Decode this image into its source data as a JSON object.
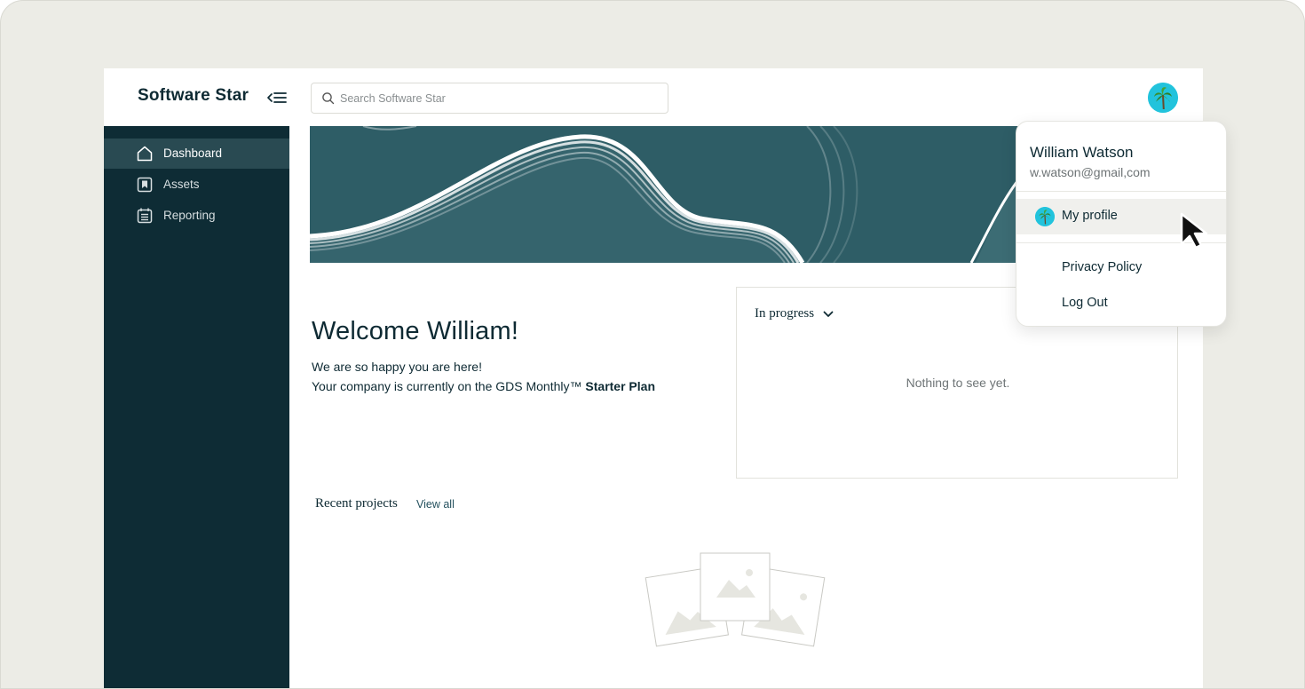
{
  "header": {
    "brand": "Software Star",
    "search_placeholder": "Search Software Star"
  },
  "sidebar": {
    "items": [
      {
        "label": "Dashboard",
        "icon": "home-icon",
        "active": true
      },
      {
        "label": "Assets",
        "icon": "assets-icon",
        "active": false
      },
      {
        "label": "Reporting",
        "icon": "reporting-icon",
        "active": false
      }
    ]
  },
  "welcome": {
    "title": "Welcome William!",
    "line1": "We are so happy you are here!",
    "line2_prefix": "Your company is currently on the GDS Monthly™ ",
    "line2_plan": "Starter Plan"
  },
  "progress": {
    "toggle_label": "In progress",
    "empty_message": "Nothing to see yet."
  },
  "recent": {
    "title": "Recent projects",
    "view_all": "View all"
  },
  "user_menu": {
    "name": "William Watson",
    "email": "w.watson@gmail,com",
    "items": [
      {
        "label": "My profile",
        "icon": "avatar"
      },
      {
        "label": "Privacy Policy"
      },
      {
        "label": "Log Out"
      }
    ]
  },
  "colors": {
    "sidebar_bg": "#0e2c35",
    "sidebar_active": "#294a52",
    "banner_bg": "#2e5d66",
    "frame_bg": "#ecece6",
    "accent_text": "#24515e"
  }
}
